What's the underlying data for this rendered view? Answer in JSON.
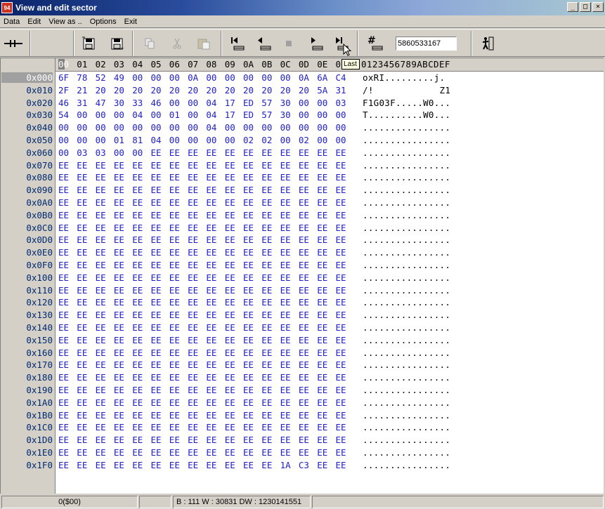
{
  "window": {
    "title": "View and edit sector",
    "app_icon_text": "94"
  },
  "menu": [
    "Data",
    "Edit",
    "View as ..",
    "Options",
    "Exit"
  ],
  "toolbar": {
    "goto_value": "5860533167",
    "tooltip": "Last",
    "icons": [
      "split-icon",
      "save-icon",
      "save-as-icon",
      "copy-icon",
      "cut-icon",
      "paste-icon",
      "first-icon",
      "previous-icon",
      "stop-icon",
      "next-icon",
      "last-icon",
      "goto-icon",
      "exit-icon"
    ]
  },
  "hex": {
    "column_headers": [
      "00",
      "01",
      "02",
      "03",
      "04",
      "05",
      "06",
      "07",
      "08",
      "09",
      "0A",
      "0B",
      "0C",
      "0D",
      "0E",
      "0"
    ],
    "ascii_header": "0123456789ABCDEF",
    "rows": [
      {
        "offset": "0x000",
        "bytes": [
          "6F",
          "78",
          "52",
          "49",
          "00",
          "00",
          "00",
          "0A",
          "00",
          "00",
          "00",
          "00",
          "00",
          "0A",
          "6A",
          "C4"
        ],
        "ascii": "oxRI.........j."
      },
      {
        "offset": "0x010",
        "bytes": [
          "2F",
          "21",
          "20",
          "20",
          "20",
          "20",
          "20",
          "20",
          "20",
          "20",
          "20",
          "20",
          "20",
          "20",
          "5A",
          "31"
        ],
        "ascii": "/!            Z1"
      },
      {
        "offset": "0x020",
        "bytes": [
          "46",
          "31",
          "47",
          "30",
          "33",
          "46",
          "00",
          "00",
          "04",
          "17",
          "ED",
          "57",
          "30",
          "00",
          "00",
          "03"
        ],
        "ascii": "F1G03F.....W0..."
      },
      {
        "offset": "0x030",
        "bytes": [
          "54",
          "00",
          "00",
          "00",
          "04",
          "00",
          "01",
          "00",
          "04",
          "17",
          "ED",
          "57",
          "30",
          "00",
          "00",
          "00"
        ],
        "ascii": "T..........W0..."
      },
      {
        "offset": "0x040",
        "bytes": [
          "00",
          "00",
          "00",
          "00",
          "00",
          "00",
          "00",
          "00",
          "04",
          "00",
          "00",
          "00",
          "00",
          "00",
          "00",
          "00"
        ],
        "ascii": "................"
      },
      {
        "offset": "0x050",
        "bytes": [
          "00",
          "00",
          "00",
          "01",
          "81",
          "04",
          "00",
          "00",
          "00",
          "00",
          "02",
          "02",
          "00",
          "02",
          "00",
          "00"
        ],
        "ascii": "................"
      },
      {
        "offset": "0x060",
        "bytes": [
          "00",
          "03",
          "03",
          "00",
          "00",
          "EE",
          "EE",
          "EE",
          "EE",
          "EE",
          "EE",
          "EE",
          "EE",
          "EE",
          "EE",
          "EE"
        ],
        "ascii": "................"
      },
      {
        "offset": "0x070",
        "bytes": [
          "EE",
          "EE",
          "EE",
          "EE",
          "EE",
          "EE",
          "EE",
          "EE",
          "EE",
          "EE",
          "EE",
          "EE",
          "EE",
          "EE",
          "EE",
          "EE"
        ],
        "ascii": "................"
      },
      {
        "offset": "0x080",
        "bytes": [
          "EE",
          "EE",
          "EE",
          "EE",
          "EE",
          "EE",
          "EE",
          "EE",
          "EE",
          "EE",
          "EE",
          "EE",
          "EE",
          "EE",
          "EE",
          "EE"
        ],
        "ascii": "................"
      },
      {
        "offset": "0x090",
        "bytes": [
          "EE",
          "EE",
          "EE",
          "EE",
          "EE",
          "EE",
          "EE",
          "EE",
          "EE",
          "EE",
          "EE",
          "EE",
          "EE",
          "EE",
          "EE",
          "EE"
        ],
        "ascii": "................"
      },
      {
        "offset": "0x0A0",
        "bytes": [
          "EE",
          "EE",
          "EE",
          "EE",
          "EE",
          "EE",
          "EE",
          "EE",
          "EE",
          "EE",
          "EE",
          "EE",
          "EE",
          "EE",
          "EE",
          "EE"
        ],
        "ascii": "................"
      },
      {
        "offset": "0x0B0",
        "bytes": [
          "EE",
          "EE",
          "EE",
          "EE",
          "EE",
          "EE",
          "EE",
          "EE",
          "EE",
          "EE",
          "EE",
          "EE",
          "EE",
          "EE",
          "EE",
          "EE"
        ],
        "ascii": "................"
      },
      {
        "offset": "0x0C0",
        "bytes": [
          "EE",
          "EE",
          "EE",
          "EE",
          "EE",
          "EE",
          "EE",
          "EE",
          "EE",
          "EE",
          "EE",
          "EE",
          "EE",
          "EE",
          "EE",
          "EE"
        ],
        "ascii": "................"
      },
      {
        "offset": "0x0D0",
        "bytes": [
          "EE",
          "EE",
          "EE",
          "EE",
          "EE",
          "EE",
          "EE",
          "EE",
          "EE",
          "EE",
          "EE",
          "EE",
          "EE",
          "EE",
          "EE",
          "EE"
        ],
        "ascii": "................"
      },
      {
        "offset": "0x0E0",
        "bytes": [
          "EE",
          "EE",
          "EE",
          "EE",
          "EE",
          "EE",
          "EE",
          "EE",
          "EE",
          "EE",
          "EE",
          "EE",
          "EE",
          "EE",
          "EE",
          "EE"
        ],
        "ascii": "................"
      },
      {
        "offset": "0x0F0",
        "bytes": [
          "EE",
          "EE",
          "EE",
          "EE",
          "EE",
          "EE",
          "EE",
          "EE",
          "EE",
          "EE",
          "EE",
          "EE",
          "EE",
          "EE",
          "EE",
          "EE"
        ],
        "ascii": "................"
      },
      {
        "offset": "0x100",
        "bytes": [
          "EE",
          "EE",
          "EE",
          "EE",
          "EE",
          "EE",
          "EE",
          "EE",
          "EE",
          "EE",
          "EE",
          "EE",
          "EE",
          "EE",
          "EE",
          "EE"
        ],
        "ascii": "................"
      },
      {
        "offset": "0x110",
        "bytes": [
          "EE",
          "EE",
          "EE",
          "EE",
          "EE",
          "EE",
          "EE",
          "EE",
          "EE",
          "EE",
          "EE",
          "EE",
          "EE",
          "EE",
          "EE",
          "EE"
        ],
        "ascii": "................"
      },
      {
        "offset": "0x120",
        "bytes": [
          "EE",
          "EE",
          "EE",
          "EE",
          "EE",
          "EE",
          "EE",
          "EE",
          "EE",
          "EE",
          "EE",
          "EE",
          "EE",
          "EE",
          "EE",
          "EE"
        ],
        "ascii": "................"
      },
      {
        "offset": "0x130",
        "bytes": [
          "EE",
          "EE",
          "EE",
          "EE",
          "EE",
          "EE",
          "EE",
          "EE",
          "EE",
          "EE",
          "EE",
          "EE",
          "EE",
          "EE",
          "EE",
          "EE"
        ],
        "ascii": "................"
      },
      {
        "offset": "0x140",
        "bytes": [
          "EE",
          "EE",
          "EE",
          "EE",
          "EE",
          "EE",
          "EE",
          "EE",
          "EE",
          "EE",
          "EE",
          "EE",
          "EE",
          "EE",
          "EE",
          "EE"
        ],
        "ascii": "................"
      },
      {
        "offset": "0x150",
        "bytes": [
          "EE",
          "EE",
          "EE",
          "EE",
          "EE",
          "EE",
          "EE",
          "EE",
          "EE",
          "EE",
          "EE",
          "EE",
          "EE",
          "EE",
          "EE",
          "EE"
        ],
        "ascii": "................"
      },
      {
        "offset": "0x160",
        "bytes": [
          "EE",
          "EE",
          "EE",
          "EE",
          "EE",
          "EE",
          "EE",
          "EE",
          "EE",
          "EE",
          "EE",
          "EE",
          "EE",
          "EE",
          "EE",
          "EE"
        ],
        "ascii": "................"
      },
      {
        "offset": "0x170",
        "bytes": [
          "EE",
          "EE",
          "EE",
          "EE",
          "EE",
          "EE",
          "EE",
          "EE",
          "EE",
          "EE",
          "EE",
          "EE",
          "EE",
          "EE",
          "EE",
          "EE"
        ],
        "ascii": "................"
      },
      {
        "offset": "0x180",
        "bytes": [
          "EE",
          "EE",
          "EE",
          "EE",
          "EE",
          "EE",
          "EE",
          "EE",
          "EE",
          "EE",
          "EE",
          "EE",
          "EE",
          "EE",
          "EE",
          "EE"
        ],
        "ascii": "................"
      },
      {
        "offset": "0x190",
        "bytes": [
          "EE",
          "EE",
          "EE",
          "EE",
          "EE",
          "EE",
          "EE",
          "EE",
          "EE",
          "EE",
          "EE",
          "EE",
          "EE",
          "EE",
          "EE",
          "EE"
        ],
        "ascii": "................"
      },
      {
        "offset": "0x1A0",
        "bytes": [
          "EE",
          "EE",
          "EE",
          "EE",
          "EE",
          "EE",
          "EE",
          "EE",
          "EE",
          "EE",
          "EE",
          "EE",
          "EE",
          "EE",
          "EE",
          "EE"
        ],
        "ascii": "................"
      },
      {
        "offset": "0x1B0",
        "bytes": [
          "EE",
          "EE",
          "EE",
          "EE",
          "EE",
          "EE",
          "EE",
          "EE",
          "EE",
          "EE",
          "EE",
          "EE",
          "EE",
          "EE",
          "EE",
          "EE"
        ],
        "ascii": "................"
      },
      {
        "offset": "0x1C0",
        "bytes": [
          "EE",
          "EE",
          "EE",
          "EE",
          "EE",
          "EE",
          "EE",
          "EE",
          "EE",
          "EE",
          "EE",
          "EE",
          "EE",
          "EE",
          "EE",
          "EE"
        ],
        "ascii": "................"
      },
      {
        "offset": "0x1D0",
        "bytes": [
          "EE",
          "EE",
          "EE",
          "EE",
          "EE",
          "EE",
          "EE",
          "EE",
          "EE",
          "EE",
          "EE",
          "EE",
          "EE",
          "EE",
          "EE",
          "EE"
        ],
        "ascii": "................"
      },
      {
        "offset": "0x1E0",
        "bytes": [
          "EE",
          "EE",
          "EE",
          "EE",
          "EE",
          "EE",
          "EE",
          "EE",
          "EE",
          "EE",
          "EE",
          "EE",
          "EE",
          "EE",
          "EE",
          "EE"
        ],
        "ascii": "................"
      },
      {
        "offset": "0x1F0",
        "bytes": [
          "EE",
          "EE",
          "EE",
          "EE",
          "EE",
          "EE",
          "EE",
          "EE",
          "EE",
          "EE",
          "EE",
          "EE",
          "1A",
          "C3",
          "EE",
          "EE"
        ],
        "ascii": "................"
      }
    ]
  },
  "status": {
    "position": "0($00)",
    "values": "B : 111 W : 30831 DW : 1230141551"
  },
  "colors": {
    "byte_text": "#2020c8",
    "offset_text": "#002a70",
    "title_start": "#0a246a",
    "tooltip_bg": "#ffffe1"
  }
}
